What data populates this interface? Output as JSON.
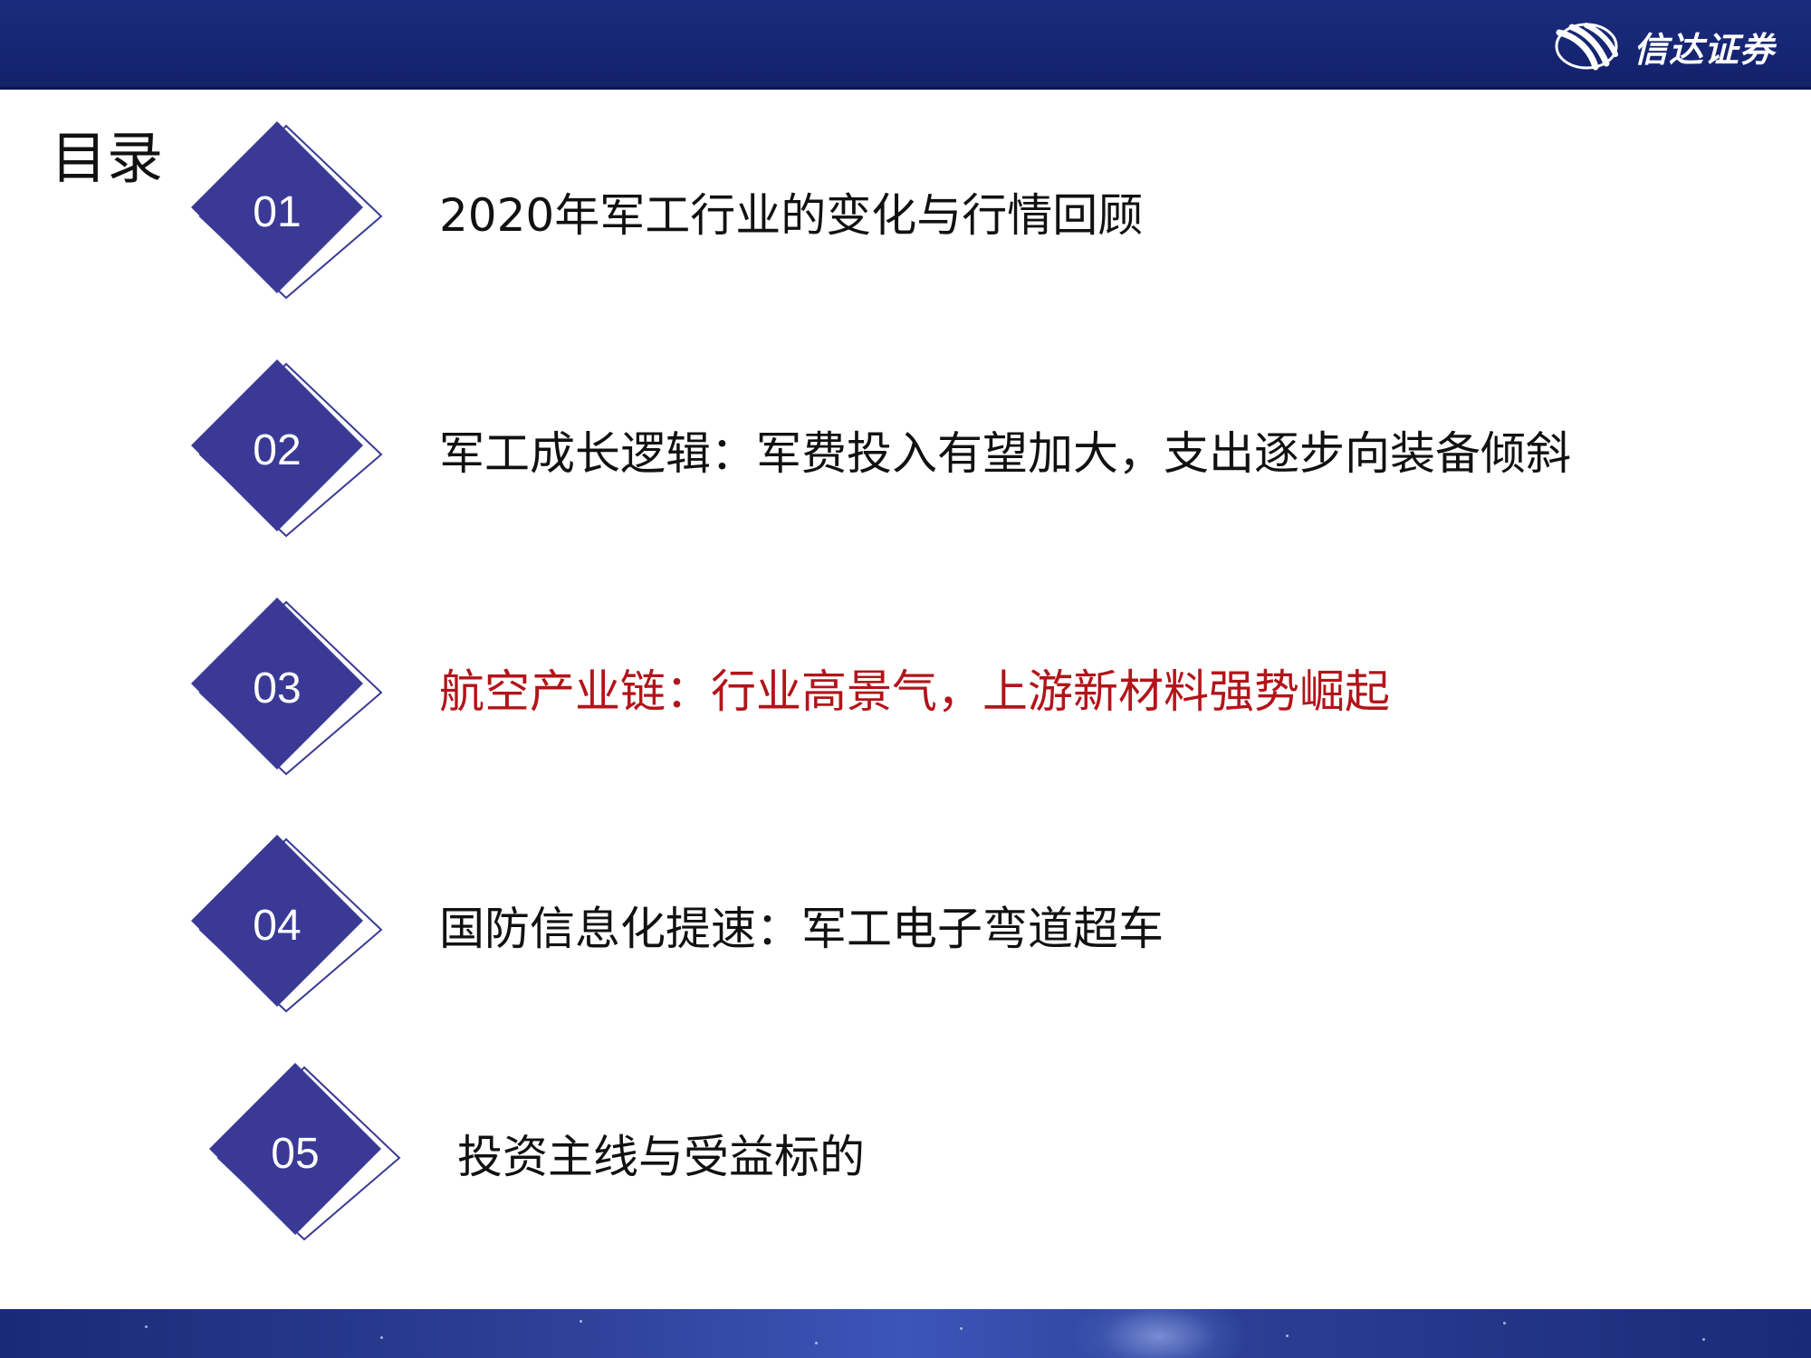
{
  "header": {
    "brand_name": "信达证券",
    "logo_icon": "xinda-swoosh-logo",
    "bar_color": "#1b2c7e"
  },
  "toc": {
    "title": "目录",
    "diamond_color": "#3a3a96",
    "active_color": "#b3141a",
    "items": [
      {
        "num": "01",
        "label": "2020年军工行业的变化与行情回顾",
        "active": false
      },
      {
        "num": "02",
        "label": "军工成长逻辑：军费投入有望加大，支出逐步向装备倾斜",
        "active": false
      },
      {
        "num": "03",
        "label": "航空产业链：行业高景气，上游新材料强势崛起",
        "active": true
      },
      {
        "num": "04",
        "label": "国防信息化提速：军工电子弯道超车",
        "active": false
      },
      {
        "num": "05",
        "label": "投资主线与受益标的",
        "active": false
      }
    ]
  }
}
